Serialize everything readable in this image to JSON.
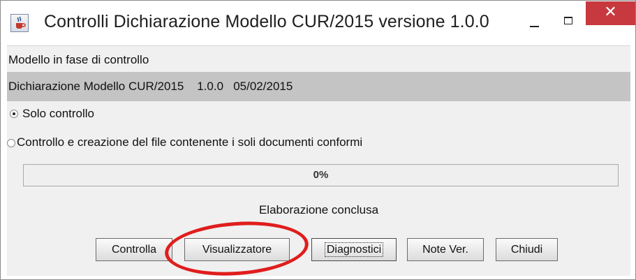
{
  "window": {
    "title": "Controlli Dichiarazione Modello CUR/2015 versione 1.0.0",
    "close_glyph": "✕"
  },
  "panel": {
    "section_label": "Modello in fase di controllo",
    "selected_model": "Dichiarazione Modello CUR/2015    1.0.0   05/02/2015"
  },
  "options": [
    {
      "label": "Solo controllo",
      "checked": true
    },
    {
      "label": "Controllo e creazione del file contenente i soli documenti conformi",
      "checked": false
    }
  ],
  "progress": {
    "value": 0,
    "text": "0%"
  },
  "status": "Elaborazione conclusa",
  "buttons": {
    "controlla": "Controlla",
    "visualizzatore": "Visualizzatore",
    "diagnostici": "Diagnostici",
    "note_ver": "Note Ver.",
    "chiudi": "Chiudi"
  },
  "annotation": {
    "color": "#e01d1d",
    "highlights": "Visualizzatore"
  },
  "icons": {
    "app": "java-cup-icon",
    "minimize": "minimize-icon",
    "maximize": "maximize-icon",
    "close": "close-icon"
  }
}
